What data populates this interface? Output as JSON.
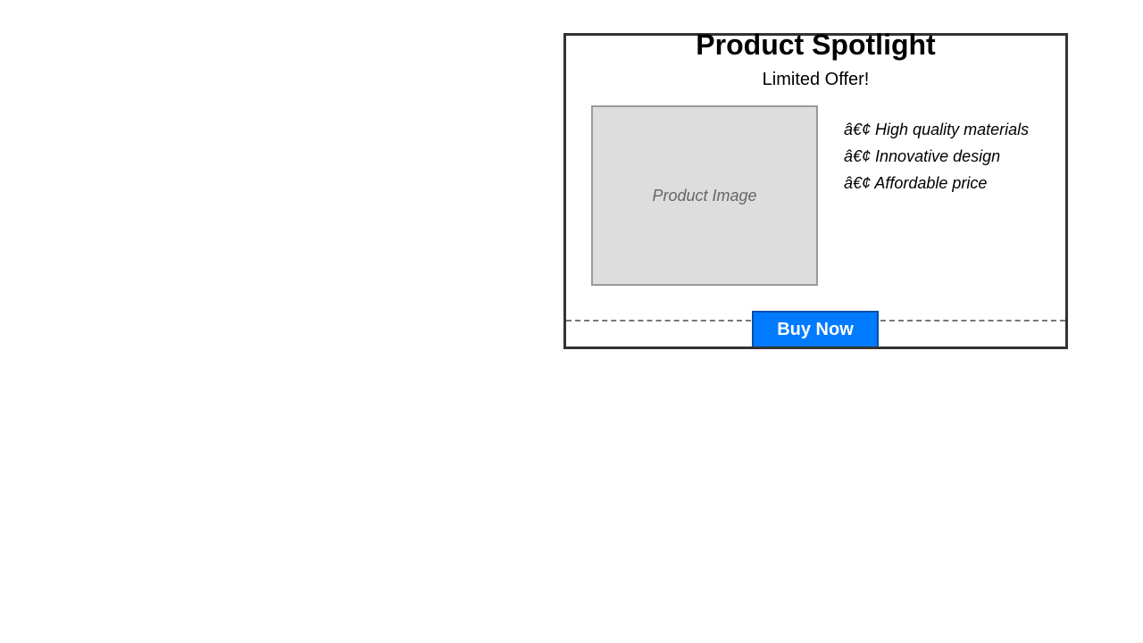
{
  "card": {
    "title": "Product Spotlight",
    "subtitle": "Limited Offer!",
    "image_placeholder": "Product Image",
    "features": [
      "â€¢ High quality materials",
      "â€¢ Innovative design",
      "â€¢ Affordable price"
    ],
    "buy_label": "Buy Now"
  },
  "colors": {
    "button_bg": "#007bff",
    "border": "#333333",
    "image_bg": "#dddddd"
  }
}
